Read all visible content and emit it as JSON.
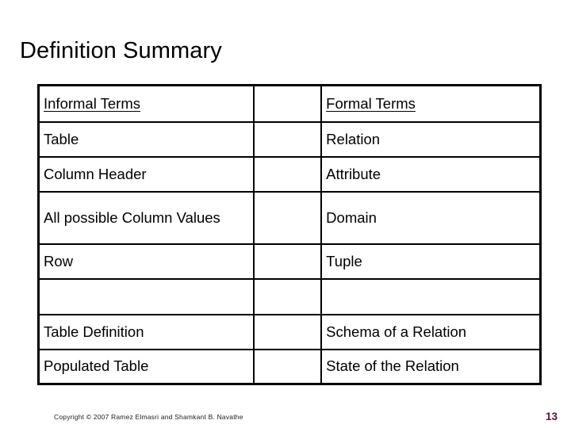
{
  "slide": {
    "title": "Definition Summary",
    "page_number": "13",
    "page_number_color": "#5f1038",
    "copyright": "Copyright © 2007 Ramez Elmasri and Shamkant B. Navathe",
    "background_color": "#ffffff",
    "text_color": "#000000",
    "border_color": "#000000"
  },
  "table": {
    "columns": [
      "informal",
      "spacer",
      "formal"
    ],
    "rows": [
      {
        "informal": "Informal Terms",
        "spacer": "",
        "formal": "Formal Terms",
        "style": "header"
      },
      {
        "informal": "Table",
        "spacer": "",
        "formal": "Relation",
        "style": "normal"
      },
      {
        "informal": "Column Header",
        "spacer": "",
        "formal": "Attribute",
        "style": "normal"
      },
      {
        "informal": "All possible Column Values",
        "spacer": "",
        "formal": "Domain",
        "style": "tall"
      },
      {
        "informal": "Row",
        "spacer": "",
        "formal": "Tuple",
        "style": "normal"
      },
      {
        "informal": "",
        "spacer": "",
        "formal": "",
        "style": "empty"
      },
      {
        "informal": "Table Definition",
        "spacer": "",
        "formal": "Schema of a Relation",
        "style": "normal"
      },
      {
        "informal": "Populated Table",
        "spacer": "",
        "formal": "State of the Relation",
        "style": "normal"
      }
    ]
  }
}
